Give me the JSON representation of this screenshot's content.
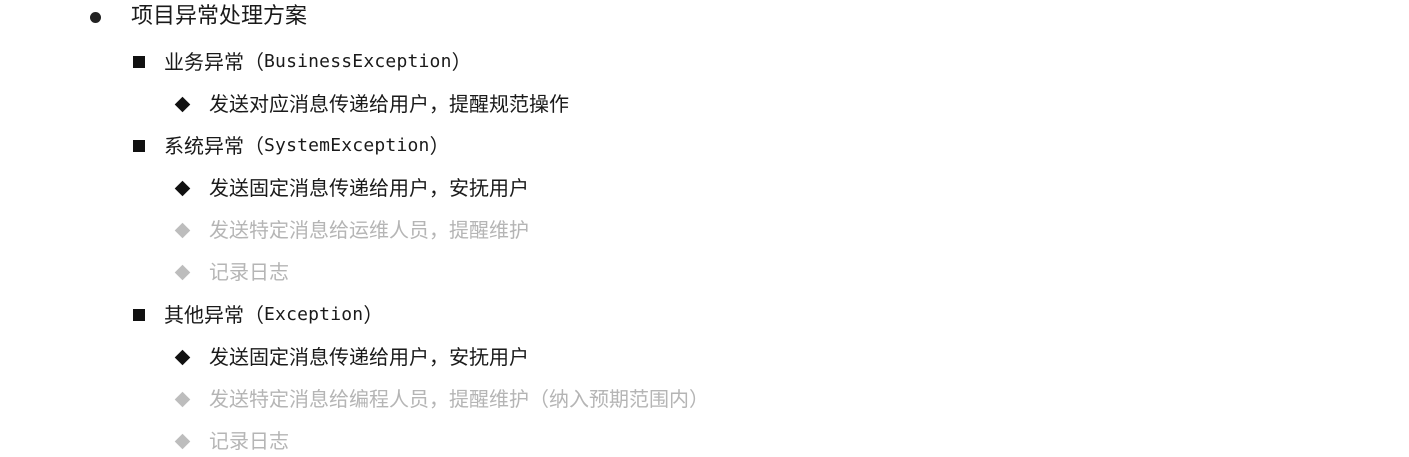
{
  "outline": {
    "title": "项目异常处理方案",
    "business": {
      "label": "业务异常",
      "open": "（",
      "code": "BusinessException",
      "close": "）",
      "items": [
        "发送对应消息传递给用户，提醒规范操作"
      ]
    },
    "system": {
      "label": "系统异常",
      "open": "（",
      "code": "SystemException",
      "close": "）",
      "items": [
        "发送固定消息传递给用户，安抚用户",
        "发送特定消息给运维人员，提醒维护",
        "记录日志"
      ]
    },
    "other": {
      "label": "其他异常",
      "open": "（",
      "code": "Exception",
      "close": "）",
      "items": [
        "发送固定消息传递给用户，安抚用户",
        "发送特定消息给编程人员，提醒维护（纳入预期范围内）",
        "记录日志"
      ]
    }
  },
  "colors": {
    "text": "#1a1a1a",
    "dimmed": "#b5b5b5"
  }
}
